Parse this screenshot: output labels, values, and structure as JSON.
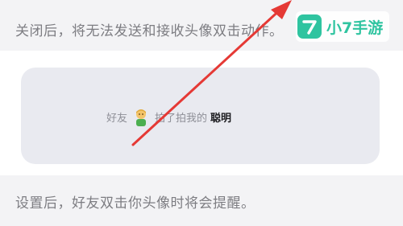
{
  "top_description": "关闭后，将无法发送和接收头像双击动作。",
  "preview": {
    "prefix": "好友",
    "avatar_icon": "person-avatar",
    "middle": "拍了拍我的",
    "suffix": "聪明"
  },
  "bottom_description": "设置后，好友双击你头像时将会提醒。",
  "watermark": {
    "brand": "小7手游",
    "mark_glyph": "7"
  },
  "colors": {
    "background": "#f3f3f5",
    "card": "#ffffff",
    "preview_bubble": "#e9eaf0",
    "arrow": "#e53935",
    "brand": "#2fc4a0"
  }
}
